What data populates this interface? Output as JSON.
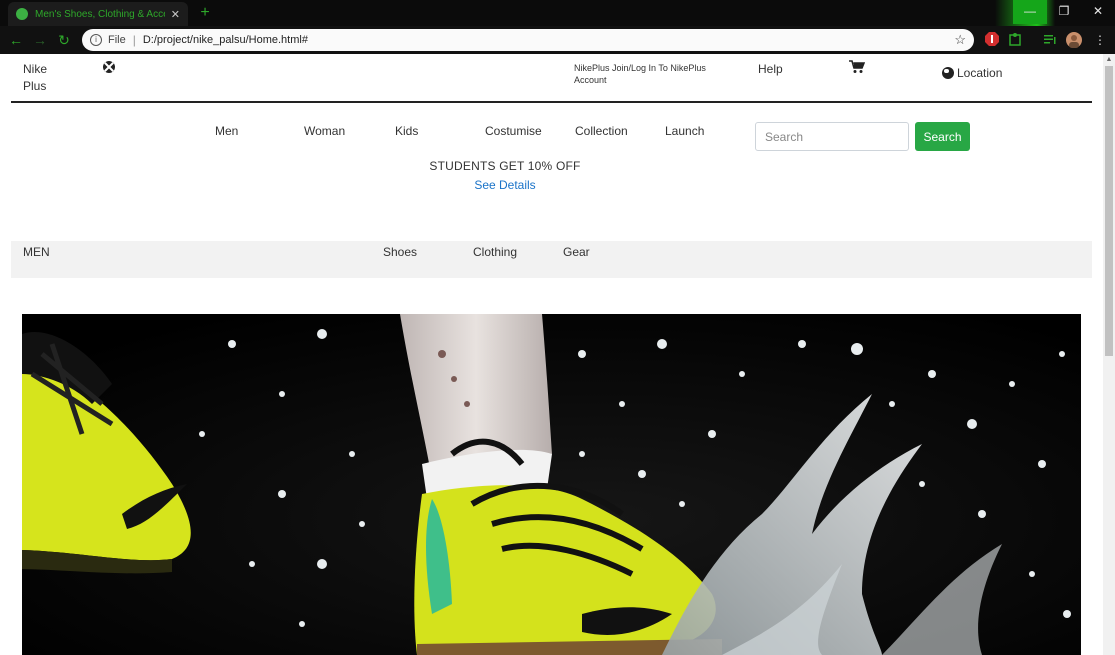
{
  "browser": {
    "tab_title": "Men's Shoes, Clothing & Accessories",
    "tab_close": "✕",
    "new_tab": "+",
    "address_scheme": "File",
    "address_url": "D:/project/nike_palsu/Home.html#",
    "window_controls": [
      "—",
      "❐",
      "✕"
    ]
  },
  "header": {
    "brand": "Nike Plus",
    "account_link": "NikePlus Join/Log In To NikePlus Account",
    "help": "Help",
    "location": "Location"
  },
  "nav": {
    "links": [
      "Men",
      "Woman",
      "Kids",
      "Costumise",
      "Collection",
      "Launch"
    ],
    "search_placeholder": "Search",
    "search_button": "Search"
  },
  "promo": {
    "headline": "STUDENTS GET 10% OFF",
    "details_link": "See Details"
  },
  "subnav": {
    "title": "MEN",
    "items": [
      "Shoes",
      "Clothing",
      "Gear"
    ]
  },
  "colors": {
    "search_button": "#28a745",
    "link": "#1a73c8",
    "browser_accent": "#2ea82a",
    "shoe_yellow": "#d4e21c"
  }
}
